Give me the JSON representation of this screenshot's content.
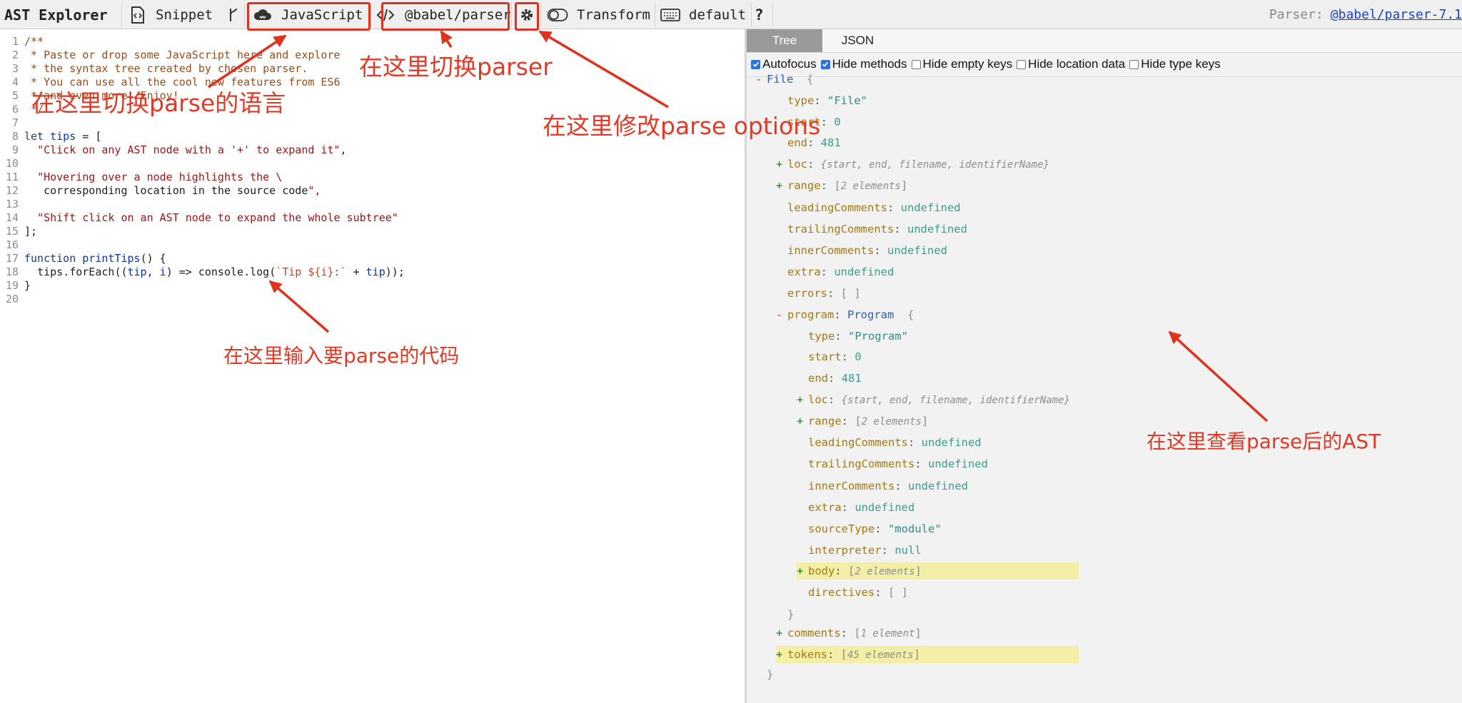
{
  "toolbar": {
    "title": "AST Explorer",
    "snippet_label": "Snippet",
    "language_label": "JavaScript",
    "parser_label": "@babel/parser",
    "transform_label": "Transform",
    "keymap_label": "default",
    "help_label": "?",
    "parser_info_label": "Parser:",
    "parser_version": "@babel/parser-7.1"
  },
  "editor": {
    "lines": [
      {
        "n": "1",
        "text": "/**"
      },
      {
        "n": "2",
        "text": " * Paste or drop some JavaScript here and explore"
      },
      {
        "n": "3",
        "text": " * the syntax tree created by chosen parser."
      },
      {
        "n": "4",
        "text": " * You can use all the cool new features from ES6"
      },
      {
        "n": "5",
        "text": " * and even more. Enjoy!"
      },
      {
        "n": "6",
        "text": " */"
      },
      {
        "n": "7",
        "text": ""
      },
      {
        "n": "8",
        "text": "let tips = ["
      },
      {
        "n": "9",
        "text": "  \"Click on any AST node with a '+' to expand it\","
      },
      {
        "n": "10",
        "text": ""
      },
      {
        "n": "11",
        "text": "  \"Hovering over a node highlights the \\"
      },
      {
        "n": "12",
        "text": "   corresponding location in the source code\","
      },
      {
        "n": "13",
        "text": ""
      },
      {
        "n": "14",
        "text": "  \"Shift click on an AST node to expand the whole subtree\""
      },
      {
        "n": "15",
        "text": "];"
      },
      {
        "n": "16",
        "text": ""
      },
      {
        "n": "17",
        "text": "function printTips() {"
      },
      {
        "n": "18",
        "text": "  tips.forEach((tip, i) => console.log(`Tip ${i}:` + tip));"
      },
      {
        "n": "19",
        "text": "}"
      },
      {
        "n": "20",
        "text": ""
      }
    ]
  },
  "output": {
    "tabs": [
      "Tree",
      "JSON"
    ],
    "options": [
      {
        "label": "Autofocus",
        "checked": true
      },
      {
        "label": "Hide methods",
        "checked": true
      },
      {
        "label": "Hide empty keys",
        "checked": false
      },
      {
        "label": "Hide location data",
        "checked": false
      },
      {
        "label": "Hide type keys",
        "checked": false
      }
    ],
    "tree": [
      {
        "id": "file",
        "indent": 0,
        "toggle": "-",
        "key": "File",
        "val": "{",
        "kind": "head"
      },
      {
        "id": "f-type",
        "indent": 1,
        "key": "type",
        "val": "\"File\"",
        "kind": "str"
      },
      {
        "id": "f-start",
        "indent": 1,
        "key": "start",
        "val": "0",
        "kind": "num"
      },
      {
        "id": "f-end",
        "indent": 1,
        "key": "end",
        "val": "481",
        "kind": "num"
      },
      {
        "id": "f-loc",
        "indent": 1,
        "toggle": "+",
        "key": "loc",
        "val": "{start, end, filename, identifierName}",
        "kind": "sum"
      },
      {
        "id": "f-range",
        "indent": 1,
        "toggle": "+",
        "key": "range",
        "val": "2 elements",
        "kind": "arr"
      },
      {
        "id": "f-lead",
        "indent": 1,
        "key": "leadingComments",
        "val": "undefined",
        "kind": "undef"
      },
      {
        "id": "f-trail",
        "indent": 1,
        "key": "trailingComments",
        "val": "undefined",
        "kind": "undef"
      },
      {
        "id": "f-inner",
        "indent": 1,
        "key": "innerComments",
        "val": "undefined",
        "kind": "undef"
      },
      {
        "id": "f-extra",
        "indent": 1,
        "key": "extra",
        "val": "undefined",
        "kind": "undef"
      },
      {
        "id": "f-errors",
        "indent": 1,
        "key": "errors",
        "val": "[ ]",
        "kind": "empty"
      },
      {
        "id": "prog",
        "indent": 1,
        "toggle": "-",
        "key": "program",
        "type": "Program",
        "val": "{",
        "kind": "typed"
      },
      {
        "id": "p-type",
        "indent": 2,
        "key": "type",
        "val": "\"Program\"",
        "kind": "str"
      },
      {
        "id": "p-start",
        "indent": 2,
        "key": "start",
        "val": "0",
        "kind": "num"
      },
      {
        "id": "p-end",
        "indent": 2,
        "key": "end",
        "val": "481",
        "kind": "num"
      },
      {
        "id": "p-loc",
        "indent": 2,
        "toggle": "+",
        "key": "loc",
        "val": "{start, end, filename, identifierName}",
        "kind": "sum"
      },
      {
        "id": "p-range",
        "indent": 2,
        "toggle": "+",
        "key": "range",
        "val": "2 elements",
        "kind": "arr"
      },
      {
        "id": "p-lead",
        "indent": 2,
        "key": "leadingComments",
        "val": "undefined",
        "kind": "undef"
      },
      {
        "id": "p-trail",
        "indent": 2,
        "key": "trailingComments",
        "val": "undefined",
        "kind": "undef"
      },
      {
        "id": "p-inner",
        "indent": 2,
        "key": "innerComments",
        "val": "undefined",
        "kind": "undef"
      },
      {
        "id": "p-extra",
        "indent": 2,
        "key": "extra",
        "val": "undefined",
        "kind": "undef"
      },
      {
        "id": "p-src",
        "indent": 2,
        "key": "sourceType",
        "val": "\"module\"",
        "kind": "str"
      },
      {
        "id": "p-interp",
        "indent": 2,
        "key": "interpreter",
        "val": "null",
        "kind": "undef"
      },
      {
        "id": "p-body",
        "indent": 2,
        "toggle": "+",
        "key": "body",
        "val": "2 elements",
        "kind": "arr",
        "highlight": true
      },
      {
        "id": "p-dir",
        "indent": 2,
        "key": "directives",
        "val": "[ ]",
        "kind": "empty"
      },
      {
        "id": "p-close",
        "indent": 1,
        "key": "",
        "val": "}",
        "kind": "close"
      },
      {
        "id": "f-comments",
        "indent": 1,
        "toggle": "+",
        "key": "comments",
        "val": "1 element",
        "kind": "arr"
      },
      {
        "id": "f-tokens",
        "indent": 1,
        "toggle": "+",
        "key": "tokens",
        "val": "45 elements",
        "kind": "arr",
        "highlight": true
      },
      {
        "id": "f-close",
        "indent": 0,
        "key": "",
        "val": "}",
        "kind": "close"
      }
    ]
  },
  "annotations": {
    "language": "在这里切换parse的语言",
    "parser": "在这里切换parser",
    "options": "在这里修改parse options",
    "code": "在这里输入要parse的代码",
    "ast": "在这里查看parse后的AST"
  },
  "colors": {
    "annotation": "#e0321c",
    "tab_active": "#9a9a9a",
    "highlight": "#f4efa6",
    "link": "#1a3fcf"
  }
}
